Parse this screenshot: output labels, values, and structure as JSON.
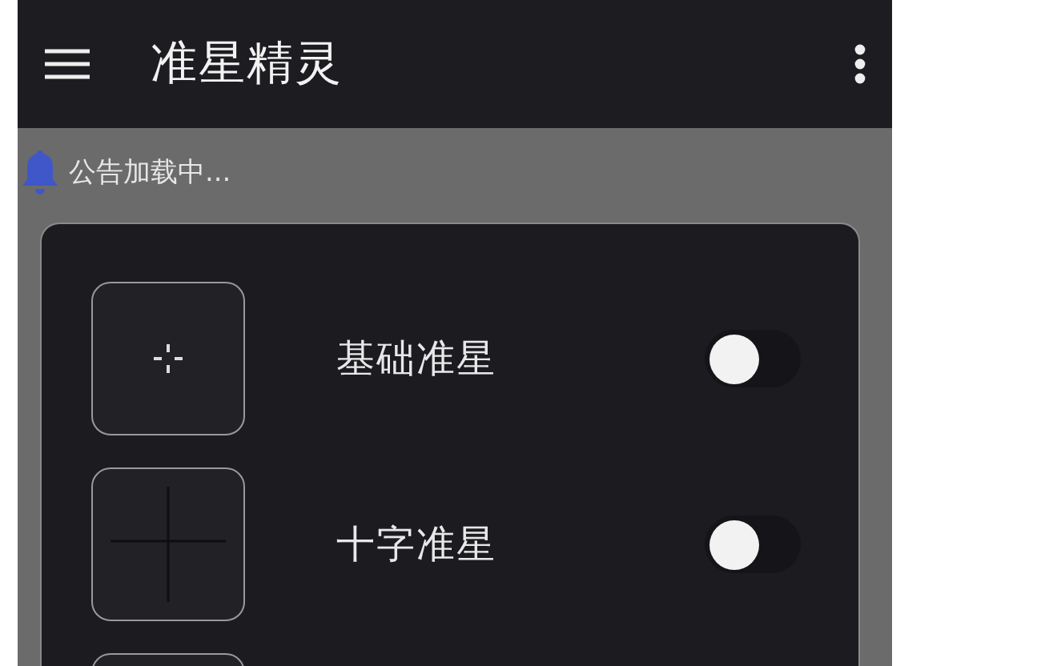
{
  "app_bar": {
    "title": "准星精灵"
  },
  "notice": {
    "text": "公告加载中..."
  },
  "crosshairs": [
    {
      "kind": "dot-cross",
      "label": "基础准星",
      "on": false
    },
    {
      "kind": "cross",
      "label": "十字准星",
      "on": false
    },
    {
      "kind": "cut-off"
    }
  ]
}
